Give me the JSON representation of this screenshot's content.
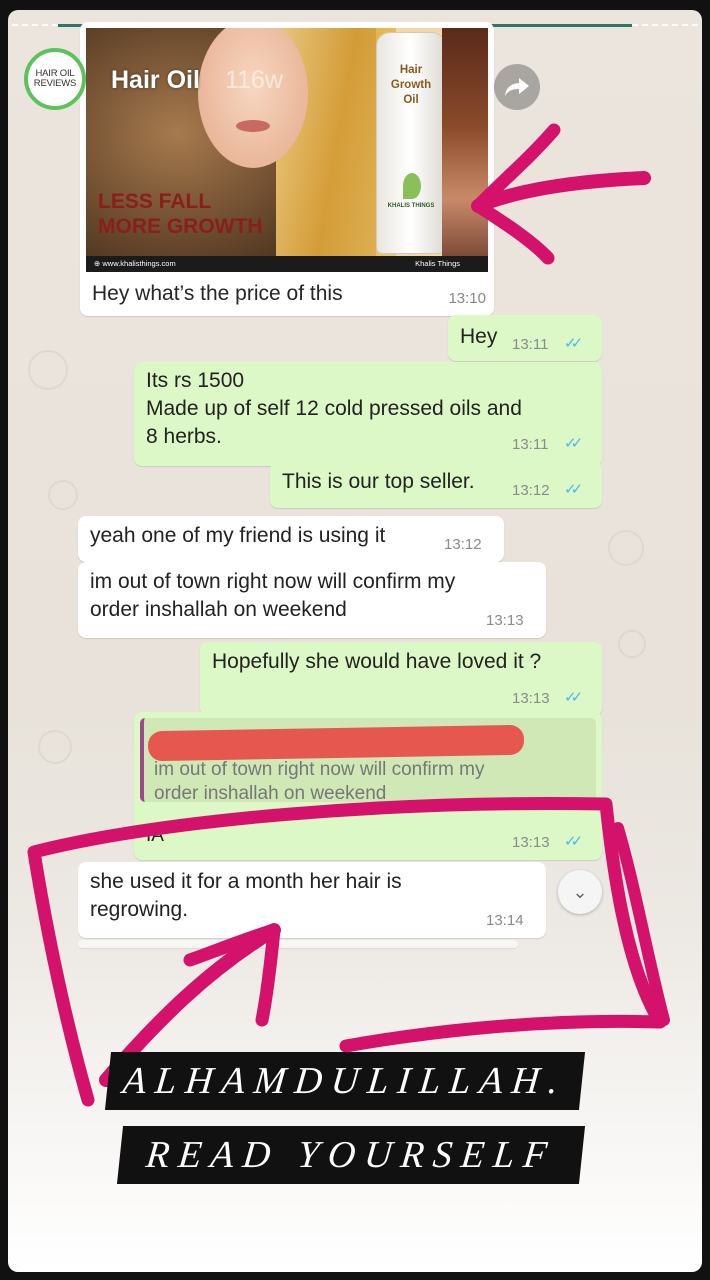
{
  "story": {
    "avatar_line1": "HAIR OIL",
    "avatar_line2": "REVIEWS",
    "account_name": "Hair Oil",
    "post_age": "116w",
    "share_icon": "share-arrow-icon"
  },
  "ad": {
    "slogan_line1": "LESS FALL",
    "slogan_line2": "MORE GROWTH",
    "bottle_label": "Hair\nGrowth\nOil",
    "bottle_brand": "KHALIS THINGS",
    "website": "⊕ www.khalisthings.com",
    "socials": "Khalis Things"
  },
  "messages": [
    {
      "direction": "in",
      "text": "Hey what’s the price of this",
      "time": "13:10"
    },
    {
      "direction": "out",
      "text": "Hey",
      "time": "13:11"
    },
    {
      "direction": "out",
      "text": "Its rs 1500\nMade up of self 12 cold pressed oils and\n8 herbs.",
      "time": "13:11"
    },
    {
      "direction": "out",
      "text": "This is our top seller.",
      "time": "13:12"
    },
    {
      "direction": "in",
      "text": "yeah one of my friend is using it",
      "time": "13:12"
    },
    {
      "direction": "in",
      "text": "im out of town right now will confirm my\norder inshallah on weekend",
      "time": "13:13"
    },
    {
      "direction": "out",
      "text": "Hopefully she would have loved it ?",
      "time": "13:13"
    },
    {
      "direction": "out",
      "quote": "im out of town right now will confirm my\norder inshallah on weekend",
      "text": "IA",
      "time": "13:13"
    },
    {
      "direction": "in",
      "text": "she used it for a month her hair is\nregrowing.",
      "time": "13:14"
    }
  ],
  "read_ticks": "✓✓",
  "captions": {
    "line1": "ALHAMDULILLAH.",
    "line2": "READ YOURSELF"
  },
  "colors": {
    "outgoing_bubble": "#dcf8c6",
    "incoming_bubble": "#ffffff",
    "read_ticks": "#4fb6ec",
    "annotation_marker": "#d4126b",
    "avatar_ring": "#5cc35c"
  }
}
